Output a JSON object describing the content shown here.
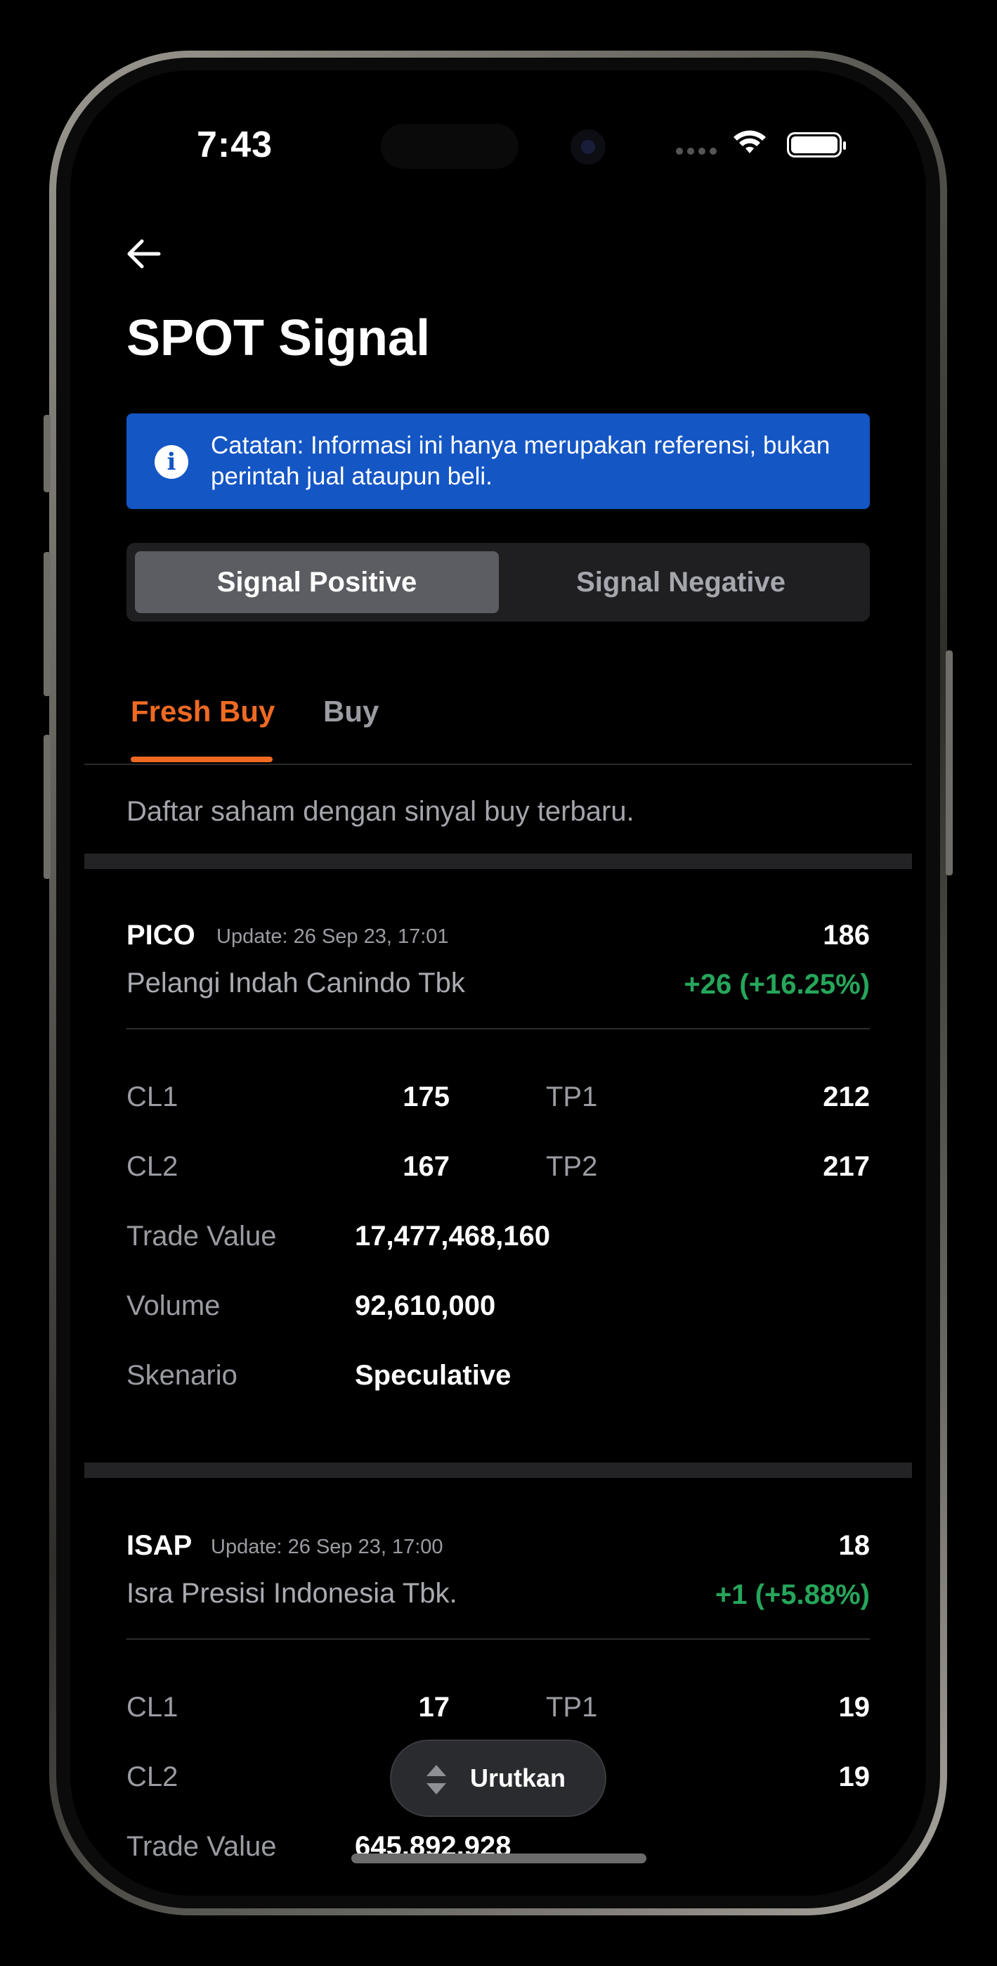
{
  "status_bar": {
    "time": "7:43"
  },
  "header": {
    "title": "SPOT Signal"
  },
  "notice": {
    "text": "Catatan: Informasi ini hanya merupakan referensi, bukan perintah jual ataupun beli."
  },
  "segments": {
    "positive": "Signal Positive",
    "negative": "Signal Negative",
    "selected": "Signal Positive"
  },
  "tabs": {
    "fresh_buy": "Fresh Buy",
    "buy": "Buy",
    "selected": "Fresh Buy"
  },
  "list": {
    "description": "Daftar saham dengan sinyal buy terbaru."
  },
  "labels": {
    "cl1": "CL1",
    "cl2": "CL2",
    "tp1": "TP1",
    "tp2": "TP2",
    "trade_value": "Trade Value",
    "volume": "Volume",
    "skenario": "Skenario"
  },
  "signals": [
    {
      "ticker": "PICO",
      "update": "Update: 26 Sep 23, 17:01",
      "company": "Pelangi Indah Canindo Tbk",
      "price": "186",
      "change": "+26 (+16.25%)",
      "cl1": "175",
      "cl2": "167",
      "tp1": "212",
      "tp2": "217",
      "trade_value": "17,477,468,160",
      "volume": "92,610,000",
      "skenario": "Speculative"
    },
    {
      "ticker": "ISAP",
      "update": "Update: 26 Sep 23, 17:00",
      "company": "Isra Presisi Indonesia Tbk.",
      "price": "18",
      "change": "+1 (+5.88%)",
      "cl1": "17",
      "tp1": "19",
      "tp2": "19",
      "trade_value": "645,892,928"
    }
  ],
  "sort_button": {
    "label": "Urutkan"
  },
  "colors": {
    "accent": "#ee6a22",
    "positive": "#26a65b",
    "notice_bg": "#1456c4"
  }
}
